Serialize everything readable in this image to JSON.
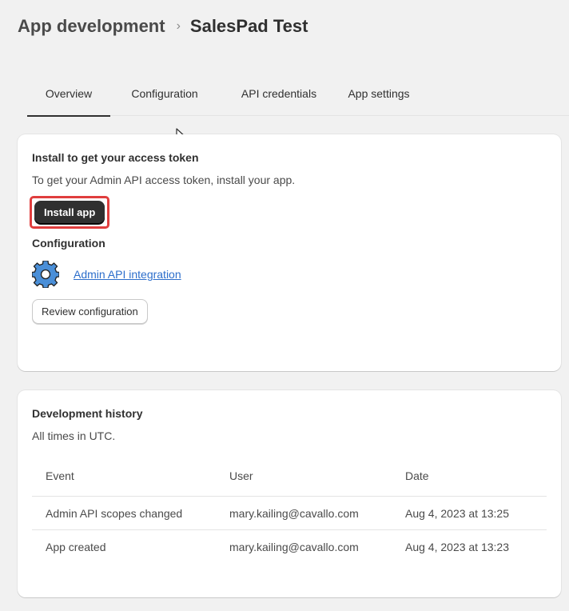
{
  "breadcrumb": {
    "parent": "App development",
    "separator": "›",
    "current": "SalesPad Test"
  },
  "tabs": [
    {
      "label": "Overview",
      "active": true
    },
    {
      "label": "Configuration",
      "active": false
    },
    {
      "label": "API credentials",
      "active": false
    },
    {
      "label": "App settings",
      "active": false
    }
  ],
  "install_card": {
    "title": "Install to get your access token",
    "description": "To get your Admin API access token, install your app.",
    "install_button": "Install app",
    "configuration_title": "Configuration",
    "integration_icon": "gear-icon",
    "integration_link": "Admin API integration",
    "review_button": "Review configuration"
  },
  "history_card": {
    "title": "Development history",
    "subtitle": "All times in UTC.",
    "columns": [
      "Event",
      "User",
      "Date"
    ],
    "rows": [
      {
        "event": "Admin API scopes changed",
        "user": "mary.kailing@cavallo.com",
        "date": "Aug 4, 2023 at 13:25"
      },
      {
        "event": "App created",
        "user": "mary.kailing@cavallo.com",
        "date": "Aug 4, 2023 at 13:23"
      }
    ]
  },
  "colors": {
    "highlight": "#e03e3e",
    "link": "#2c6ecb",
    "primary_button": "#303030"
  }
}
